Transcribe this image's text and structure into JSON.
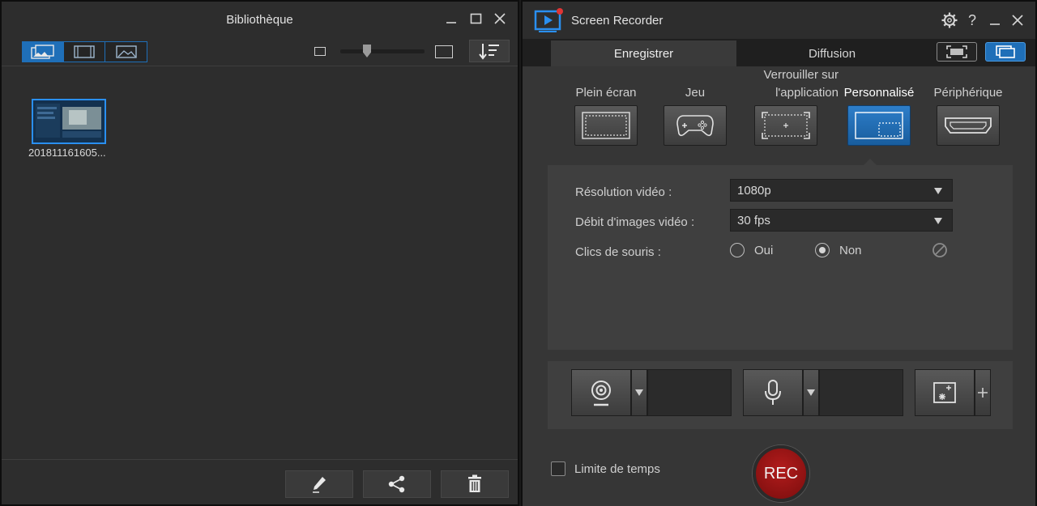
{
  "library": {
    "title": "Bibliothèque",
    "media_items": [
      {
        "name": "201811161605..."
      }
    ]
  },
  "recorder": {
    "title": "Screen Recorder",
    "help_label": "?",
    "tabs": [
      {
        "label": "Enregistrer",
        "active": true
      },
      {
        "label": "Diffusion",
        "active": false
      }
    ],
    "modes": [
      {
        "label": "Plein écran",
        "icon": "fullscreen-icon"
      },
      {
        "label": "Jeu",
        "icon": "gamepad-icon"
      },
      {
        "label_line1": "Verrouiller sur",
        "label_line2": "l'application",
        "icon": "lock-app-icon"
      },
      {
        "label": "Personnalisé",
        "icon": "custom-region-icon",
        "selected": true
      },
      {
        "label": "Périphérique",
        "icon": "hdmi-icon"
      }
    ],
    "settings": {
      "resolution_label": "Résolution vidéo :",
      "resolution_value": "1080p",
      "framerate_label": "Débit d'images vidéo :",
      "framerate_value": "30 fps",
      "mouse_label": "Clics de souris :",
      "mouse_yes": "Oui",
      "mouse_no": "Non",
      "mouse_selected": "Non"
    },
    "time_limit_label": "Limite de temps",
    "rec_label": "REC",
    "colors": {
      "accent": "#1f6fb8",
      "rec": "#a01515",
      "bg": "#2d2d2d"
    }
  }
}
